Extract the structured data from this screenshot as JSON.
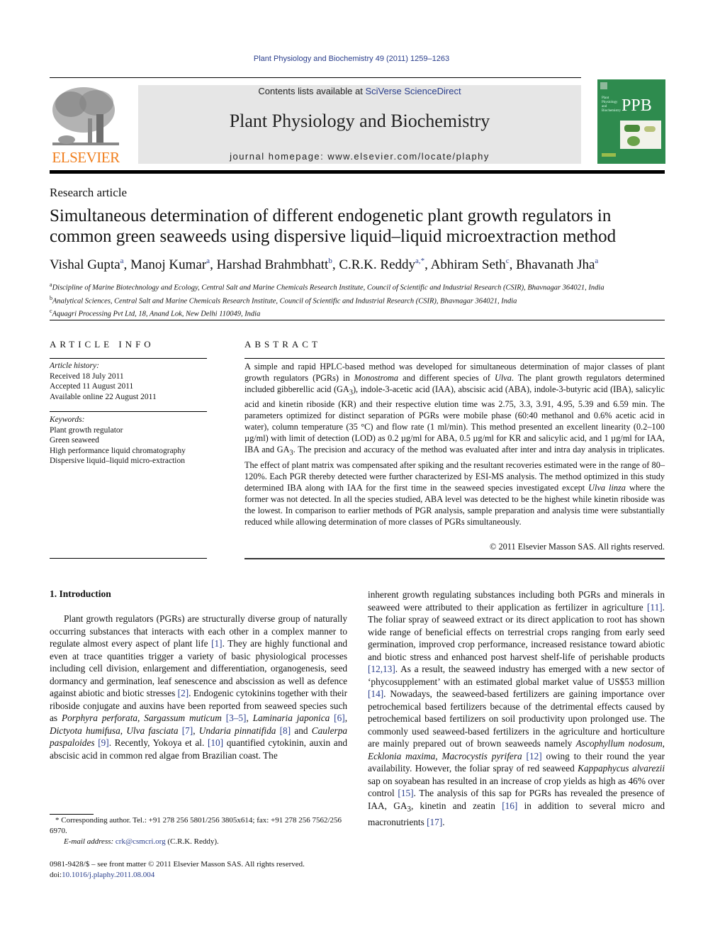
{
  "header": {
    "journal_ref": "Plant Physiology and Biochemistry 49 (2011) 1259–1263",
    "contents_prefix": "Contents lists available at ",
    "contents_link": "SciVerse ScienceDirect",
    "journal_title": "Plant Physiology and Biochemistry",
    "homepage": "journal homepage: www.elsevier.com/locate/plaphy",
    "publisher_logo": "ELSEVIER",
    "cover_abbrev": "PPB",
    "colors": {
      "link": "#2a3e8c",
      "elsevier_orange": "#f07f1e",
      "cover_green": "#2e8b4e",
      "band_gray": "#e6e6e6"
    }
  },
  "article": {
    "type": "Research article",
    "title": "Simultaneous determination of different endogenetic plant growth regulators in common green seaweeds using dispersive liquid–liquid microextraction method",
    "authors": [
      {
        "name": "Vishal Gupta",
        "aff": "a"
      },
      {
        "name": "Manoj Kumar",
        "aff": "a"
      },
      {
        "name": "Harshad Brahmbhatt",
        "aff": "b"
      },
      {
        "name": "C.R.K. Reddy",
        "aff": "a,*"
      },
      {
        "name": "Abhiram Seth",
        "aff": "c"
      },
      {
        "name": "Bhavanath Jha",
        "aff": "a"
      }
    ],
    "affiliations": [
      {
        "key": "a",
        "text": "Discipline of Marine Biotechnology and Ecology, Central Salt and Marine Chemicals Research Institute, Council of Scientific and Industrial Research (CSIR), Bhavnagar 364021, India"
      },
      {
        "key": "b",
        "text": "Analytical Sciences, Central Salt and Marine Chemicals Research Institute, Council of Scientific and Industrial Research (CSIR), Bhavnagar 364021, India"
      },
      {
        "key": "c",
        "text": "Aquagri Processing Pvt Ltd, 18, Anand Lok, New Delhi 110049, India"
      }
    ]
  },
  "article_info": {
    "heading": "ARTICLE INFO",
    "history_label": "Article history:",
    "history": [
      "Received 18 July 2011",
      "Accepted 11 August 2011",
      "Available online 22 August 2011"
    ],
    "keywords_label": "Keywords:",
    "keywords": [
      "Plant growth regulator",
      "Green seaweed",
      "High performance liquid chromatography",
      "Dispersive liquid–liquid micro-extraction"
    ]
  },
  "abstract": {
    "heading": "ABSTRACT",
    "p1": "A simple and rapid HPLC-based method was developed for simultaneous determination of major classes of plant growth regulators (PGRs) in ",
    "i1": "Monostroma",
    "p2": " and different species of ",
    "i2": "Ulva",
    "p3": ". The plant growth regulators determined included gibberellic acid (GA",
    "sub1": "3",
    "p4": "), indole-3-acetic acid (IAA), abscisic acid (ABA), indole-3-butyric acid (IBA), salicylic acid and kinetin riboside (KR) and their respective elution time was 2.75, 3.3, 3.91, 4.95, 5.39 and 6.59 min. The parameters optimized for distinct separation of PGRs were mobile phase (60:40 methanol and 0.6% acetic acid in water), column temperature (35 °C) and flow rate (1 ml/min). This method presented an excellent linearity (0.2–100 µg/ml) with limit of detection (LOD) as 0.2 µg/ml for ABA, 0.5 µg/ml for KR and salicylic acid, and 1 µg/ml for IAA, IBA and GA",
    "sub2": "3",
    "p5": ". The precision and accuracy of the method was evaluated after inter and intra day analysis in triplicates. The effect of plant matrix was compensated after spiking and the resultant recoveries estimated were in the range of 80–120%. Each PGR thereby detected were further characterized by ESI-MS analysis. The method optimized in this study determined IBA along with IAA for the first time in the seaweed species investigated except ",
    "i3": "Ulva linza",
    "p6": " where the former was not detected. In all the species studied, ABA level was detected to be the highest while kinetin riboside was the lowest. In comparison to earlier methods of PGR analysis, sample preparation and analysis time were substantially reduced while allowing determination of more classes of PGRs simultaneously.",
    "copyright": "© 2011 Elsevier Masson SAS. All rights reserved."
  },
  "introduction": {
    "heading": "1.  Introduction",
    "left": {
      "t1": "Plant growth regulators (PGRs) are structurally diverse group of naturally occurring substances that interacts with each other in a complex manner to regulate almost every aspect of plant life ",
      "r1": "[1]",
      "t2": ". They are highly functional and even at trace quantities trigger a variety of basic physiological processes including cell division, enlargement and differentiation, organogenesis, seed dormancy and germination, leaf senescence and abscission as well as defence against abiotic and biotic stresses ",
      "r2": "[2]",
      "t3": ". Endogenic cytokinins together with their riboside conjugate and auxins have been reported from seaweed species such as ",
      "s1": "Porphyra perforata",
      "t4": ", ",
      "s2": "Sargassum muticum",
      "t5": " ",
      "r3": "[3–5]",
      "t6": ", ",
      "s3": "Laminaria japonica",
      "t7": " ",
      "r4": "[6]",
      "t8": ", ",
      "s4": "Dictyota humifusa",
      "t9": ", ",
      "s5": "Ulva fasciata",
      "t10": " ",
      "r5": "[7]",
      "t11": ", ",
      "s6": "Undaria pinnatifida",
      "t12": " ",
      "r6": "[8]",
      "t13": " and ",
      "s7": "Caulerpa paspaloides",
      "t14": " ",
      "r7": "[9]",
      "t15": ". Recently, Yokoya et al. ",
      "r8": "[10]",
      "t16": " quantified cytokinin, auxin and abscisic acid in common red algae from Brazilian coast. The"
    },
    "right": {
      "t1": "inherent growth regulating substances including both PGRs and minerals in seaweed were attributed to their application as fertilizer in agriculture ",
      "r1": "[11]",
      "t2": ". The foliar spray of seaweed extract or its direct application to root has shown wide range of beneficial effects on terrestrial crops ranging from early seed germination, improved crop performance, increased resistance toward abiotic and biotic stress and enhanced post harvest shelf-life of perishable products ",
      "r2": "[12,13]",
      "t3": ". As a result, the seaweed industry has emerged with a new sector of ‘phycosupplement’ with an estimated global market value of US$53 million ",
      "r3": "[14]",
      "t4": ". Nowadays, the seaweed-based fertilizers are gaining importance over petrochemical based fertilizers because of the detrimental effects caused by petrochemical based fertilizers on soil productivity upon prolonged use. The commonly used seaweed-based fertilizers in the agriculture and horticulture are mainly prepared out of brown seaweeds namely ",
      "s1": "Ascophyllum nodosum",
      "t5": ", ",
      "s2": "Ecklonia maxima",
      "t6": ", ",
      "s3": "Macrocystis pyrifera",
      "t7": " ",
      "r4": "[12]",
      "t8": " owing to their round the year availability. However, the foliar spray of red seaweed ",
      "s4": "Kappaphycus alvarezii",
      "t9": " sap on soyabean has resulted in an increase of crop yields as high as 46% over control ",
      "r5": "[15]",
      "t10": ". The analysis of this sap for PGRs has revealed the presence of IAA, GA",
      "sub": "3",
      "t11": ", kinetin and zeatin ",
      "r6": "[16]",
      "t12": " in addition to several micro and macronutrients ",
      "r7": "[17]",
      "t13": "."
    }
  },
  "footnotes": {
    "corresponding": "* Corresponding author. Tel.: +91 278 256 5801/256 3805x614; fax: +91 278 256 7562/256 6970.",
    "email_label": "E-mail address: ",
    "email": "crk@csmcri.org",
    "email_suffix": " (C.R.K. Reddy).",
    "front_matter": "0981-9428/$ – see front matter © 2011 Elsevier Masson SAS. All rights reserved.",
    "doi_label": "doi:",
    "doi": "10.1016/j.plaphy.2011.08.004"
  }
}
